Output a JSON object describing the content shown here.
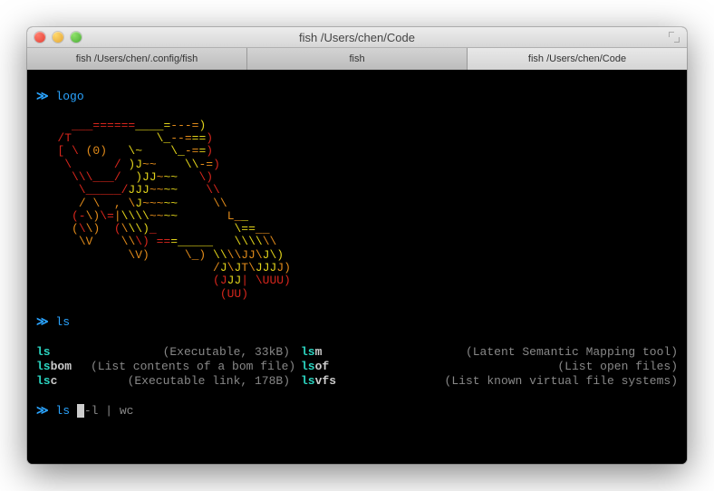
{
  "window": {
    "title": "fish  /Users/chen/Code"
  },
  "tabs": [
    {
      "label": "fish  /Users/chen/.config/fish",
      "active": false
    },
    {
      "label": "fish",
      "active": false
    },
    {
      "label": "fish  /Users/chen/Code",
      "active": true
    }
  ],
  "prompt_glyph": "≫ ",
  "history": [
    {
      "command": "logo"
    },
    {
      "command": "ls"
    }
  ],
  "completions": [
    {
      "name": "ls",
      "suffix": "",
      "desc": "(Executable, 33kB)",
      "name2": "ls",
      "suffix2": "m",
      "desc2": "(Latent Semantic Mapping tool)"
    },
    {
      "name": "ls",
      "suffix": "bom",
      "desc": "(List contents of a bom file)",
      "name2": "ls",
      "suffix2": "of",
      "desc2": "(List open files)"
    },
    {
      "name": "ls",
      "suffix": "c",
      "desc": "(Executable link, 178B)",
      "name2": "ls",
      "suffix2": "vfs",
      "desc2": "(List known virtual file systems)"
    }
  ],
  "current_input": {
    "cmd": "ls ",
    "suggestion": "-l | wc"
  },
  "ascii_art": [
    [
      [
        "r",
        "     ___"
      ],
      [
        "r",
        "======"
      ],
      [
        "y",
        "____"
      ],
      [
        "y",
        "="
      ],
      [
        "o",
        "---="
      ],
      [
        "y",
        ")"
      ]
    ],
    [
      [
        "r",
        "   /T            "
      ],
      [
        "y",
        "\\_"
      ],
      [
        "o",
        "--="
      ],
      [
        "y",
        "=="
      ],
      [
        "r",
        ")"
      ]
    ],
    [
      [
        "r",
        "   [ \\ "
      ],
      [
        "o",
        "(0)"
      ],
      [
        "r",
        "   "
      ],
      [
        "y",
        "\\~    "
      ],
      [
        "y",
        "\\_"
      ],
      [
        "o",
        "-="
      ],
      [
        "y",
        "="
      ],
      [
        "r",
        ")"
      ]
    ],
    [
      [
        "r",
        "    \\      / "
      ],
      [
        "y",
        ")J"
      ],
      [
        "o",
        "~~    "
      ],
      [
        "y",
        "\\\\"
      ],
      [
        "o",
        "-="
      ],
      [
        "r",
        ")"
      ]
    ],
    [
      [
        "r",
        "     \\\\\\___/  "
      ],
      [
        "y",
        ")JJ"
      ],
      [
        "o",
        "~"
      ],
      [
        "y",
        "~~   "
      ],
      [
        "r",
        "\\)"
      ]
    ],
    [
      [
        "r",
        "      \\_____/"
      ],
      [
        "y",
        "JJJ"
      ],
      [
        "o",
        "~~"
      ],
      [
        "y",
        "~~    "
      ],
      [
        "r",
        "\\\\"
      ]
    ],
    [
      [
        "r",
        "      "
      ],
      [
        "o",
        "/"
      ],
      [
        "r",
        " "
      ],
      [
        "o",
        "\\  "
      ],
      [
        "o",
        ", \\"
      ],
      [
        "y",
        "J"
      ],
      [
        "o",
        "~~~"
      ],
      [
        "y",
        "~~     "
      ],
      [
        "o",
        "\\\\"
      ]
    ],
    [
      [
        "r",
        "     (-"
      ],
      [
        "o",
        "\\)"
      ],
      [
        "r",
        "\\="
      ],
      [
        "o",
        "|"
      ],
      [
        "y",
        "\\\\\\\\"
      ],
      [
        "o",
        "~~"
      ],
      [
        "y",
        "~~       "
      ],
      [
        "o",
        "L_"
      ],
      [
        "y",
        "_"
      ]
    ],
    [
      [
        "r",
        "     "
      ],
      [
        "o",
        "("
      ],
      [
        "r",
        "\\"
      ],
      [
        "o",
        "\\)"
      ],
      [
        "r",
        "  ("
      ],
      [
        "o",
        "\\"
      ],
      [
        "y",
        "\\\\)"
      ],
      [
        "r",
        "_           "
      ],
      [
        "y",
        "\\=="
      ],
      [
        "o",
        "__"
      ]
    ],
    [
      [
        "r",
        "      "
      ],
      [
        "o",
        "\\V"
      ],
      [
        "r",
        "    "
      ],
      [
        "o",
        "\\\\"
      ],
      [
        "r",
        "\\) =="
      ],
      [
        "y",
        "=_____   "
      ],
      [
        "y",
        "\\\\\\\\"
      ],
      [
        "o",
        "\\\\"
      ]
    ],
    [
      [
        "r",
        "             "
      ],
      [
        "o",
        "\\V)     \\_) "
      ],
      [
        "y",
        "\\\\"
      ],
      [
        "o",
        "\\\\JJ\\"
      ],
      [
        "y",
        "J\\)"
      ]
    ],
    [
      [
        "r",
        "                         "
      ],
      [
        "o",
        "/"
      ],
      [
        "y",
        "J"
      ],
      [
        "o",
        "\\"
      ],
      [
        "y",
        "J"
      ],
      [
        "o",
        "T\\"
      ],
      [
        "y",
        "JJJ"
      ],
      [
        "o",
        "J)"
      ]
    ],
    [
      [
        "r",
        "                         (J"
      ],
      [
        "y",
        "JJ"
      ],
      [
        "r",
        "| \\UUU)"
      ]
    ],
    [
      [
        "r",
        "                          (UU)"
      ]
    ]
  ]
}
